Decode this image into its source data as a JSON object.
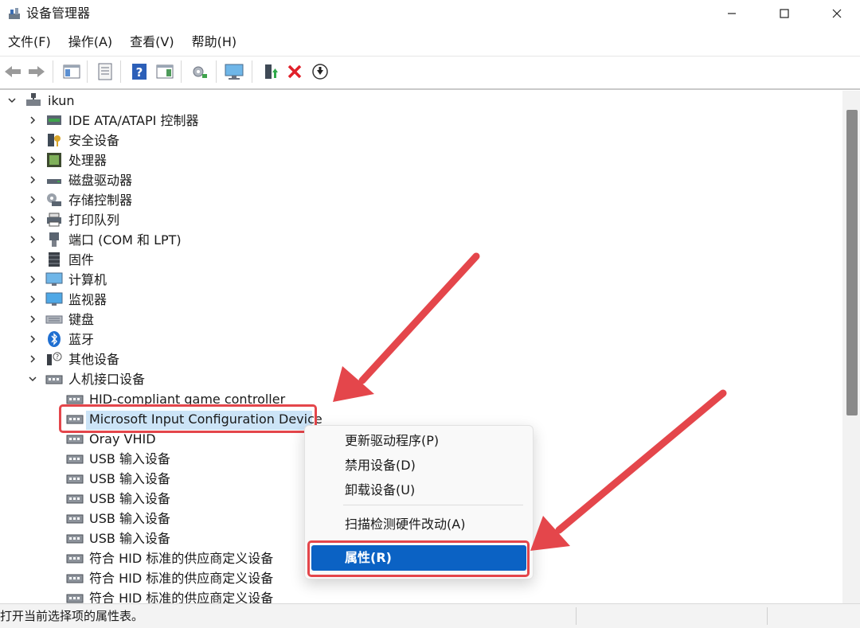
{
  "window": {
    "title": "设备管理器"
  },
  "menu": [
    {
      "label": "文件(F)"
    },
    {
      "label": "操作(A)"
    },
    {
      "label": "查看(V)"
    },
    {
      "label": "帮助(H)"
    }
  ],
  "toolbar": {
    "buttons": [
      "back-icon",
      "forward-icon",
      "show-hide-console-tree-icon",
      "properties-sheet-icon",
      "help-icon",
      "action-pane-icon",
      "scan-hardware-icon",
      "computer-monitor-icon",
      "update-driver-icon",
      "uninstall-icon",
      "disable-device-icon"
    ]
  },
  "tree": {
    "root": "ikun",
    "categories": [
      {
        "label": "IDE ATA/ATAPI 控制器"
      },
      {
        "label": "安全设备"
      },
      {
        "label": "处理器"
      },
      {
        "label": "磁盘驱动器"
      },
      {
        "label": "存储控制器"
      },
      {
        "label": "打印队列"
      },
      {
        "label": "端口 (COM 和 LPT)"
      },
      {
        "label": "固件"
      },
      {
        "label": "计算机"
      },
      {
        "label": "监视器"
      },
      {
        "label": "键盘"
      },
      {
        "label": "蓝牙"
      },
      {
        "label": "其他设备"
      },
      {
        "label": "人机接口设备"
      }
    ],
    "hid_children": [
      {
        "label": "HID-compliant game controller"
      },
      {
        "label": "Microsoft Input Configuration Device"
      },
      {
        "label": "Oray VHID"
      },
      {
        "label": "USB 输入设备"
      },
      {
        "label": "USB 输入设备"
      },
      {
        "label": "USB 输入设备"
      },
      {
        "label": "USB 输入设备"
      },
      {
        "label": "USB 输入设备"
      },
      {
        "label": "符合 HID 标准的供应商定义设备"
      },
      {
        "label": "符合 HID 标准的供应商定义设备"
      },
      {
        "label": "符合 HID 标准的供应商定义设备"
      }
    ]
  },
  "context_menu": {
    "items": [
      {
        "label": "更新驱动程序(P)"
      },
      {
        "label": "禁用设备(D)"
      },
      {
        "label": "卸载设备(U)"
      },
      {
        "label": "扫描检测硬件改动(A)"
      },
      {
        "label": "属性(R)"
      }
    ]
  },
  "status": {
    "text": "打开当前选择项的属性表。"
  },
  "colors": {
    "selection": "#cce4f7",
    "annotation_red": "#e4464b",
    "menu_highlight": "#0b62c4"
  }
}
